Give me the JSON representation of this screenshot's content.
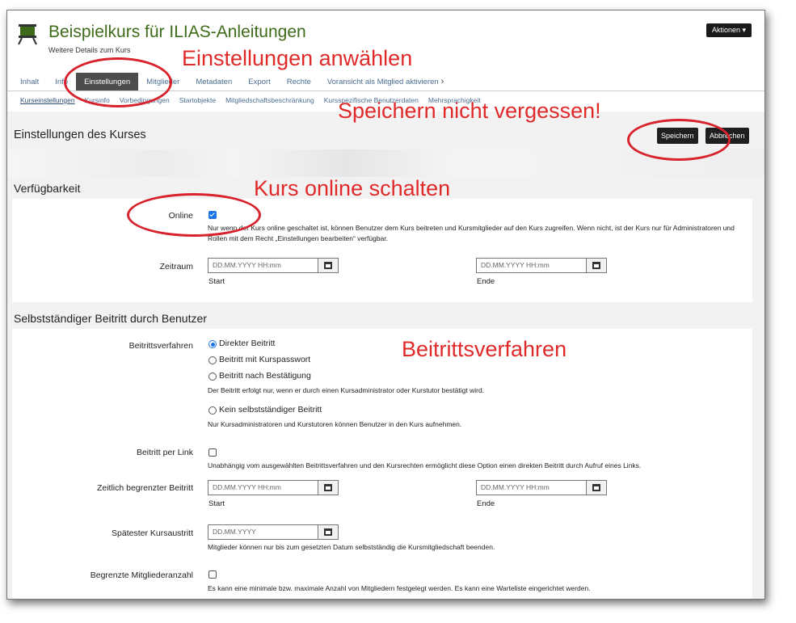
{
  "header": {
    "title": "Beispielkurs für ILIAS-Anleitungen",
    "subtitle": "Weitere Details zum Kurs",
    "actions_label": "Aktionen ▾"
  },
  "tabs": [
    {
      "label": "Inhalt"
    },
    {
      "label": "Info"
    },
    {
      "label": "Einstellungen",
      "active": true
    },
    {
      "label": "Mitglieder"
    },
    {
      "label": "Metadaten"
    },
    {
      "label": "Export"
    },
    {
      "label": "Rechte"
    },
    {
      "label": "Voransicht als Mitglied aktivieren"
    }
  ],
  "subtabs": [
    "Kurseinstellungen",
    "Kursinfo",
    "Vorbedingungen",
    "Startobjekte",
    "Mitgliedschaftsbeschränkung",
    "Kursspezifische Benutzerdaten",
    "Mehrsprachigkeit"
  ],
  "page": {
    "heading": "Einstellungen des Kurses",
    "save_label": "Speichern",
    "cancel_label": "Abbrechen"
  },
  "availability": {
    "section_title": "Verfügbarkeit",
    "online_label": "Online",
    "online_checked": true,
    "online_help": "Nur wenn der Kurs online geschaltet ist, können Benutzer dem Kurs beitreten und Kursmitglieder auf den Kurs zugreifen. Wenn nicht, ist der Kurs nur für Administratoren und Rollen mit dem Recht „Einstellungen bearbeiten“ verfügbar.",
    "period_label": "Zeitraum",
    "start_placeholder": "DD.MM.YYYY HH:mm",
    "end_placeholder": "DD.MM.YYYY HH:mm",
    "start_label": "Start",
    "end_label": "Ende"
  },
  "registration": {
    "section_title": "Selbstständiger Beitritt durch Benutzer",
    "procedure_label": "Beitrittsverfahren",
    "options": [
      {
        "label": "Direkter Beitritt",
        "checked": true
      },
      {
        "label": "Beitritt mit Kurspasswort",
        "checked": false
      },
      {
        "label": "Beitritt nach Bestätigung",
        "checked": false
      },
      {
        "label": "Kein selbstständiger Beitritt",
        "checked": false
      }
    ],
    "confirm_help": "Der Beitritt erfolgt nur, wenn er durch einen Kursadministrator oder Kurstutor bestätigt wird.",
    "none_help": "Nur Kursadministratoren und Kurstutoren können Benutzer in den Kurs aufnehmen.",
    "link_label": "Beitritt per Link",
    "link_help": "Unabhängig vom ausgewählten Beitrittsverfahren und den Kursrechten ermöglicht diese Option einen direkten Beitritt durch Aufruf eines Links.",
    "limited_label": "Zeitlich begrenzter Beitritt",
    "limited_start_placeholder": "DD.MM.YYYY HH:mm",
    "limited_end_placeholder": "DD.MM.YYYY HH:mm",
    "limited_start_label": "Start",
    "limited_end_label": "Ende",
    "leave_label": "Spätester Kursaustritt",
    "leave_placeholder": "DD.MM.YYYY",
    "leave_help": "Mitglieder können nur bis zum gesetzten Datum selbstständig die Kursmitgliedschaft beenden.",
    "max_label": "Begrenzte Mitgliederanzahl",
    "max_help": "Es kann eine minimale bzw. maximale Anzahl von Mitgliedern festgelegt werden. Es kann eine Warteliste eingerichtet werden."
  },
  "annotations": {
    "select_settings": "Einstellungen anwählen",
    "dont_forget_save": "Speichern nicht vergessen!",
    "switch_online": "Kurs online schalten",
    "procedure": "Beitrittsverfahren",
    "color": "#e02a2a"
  }
}
